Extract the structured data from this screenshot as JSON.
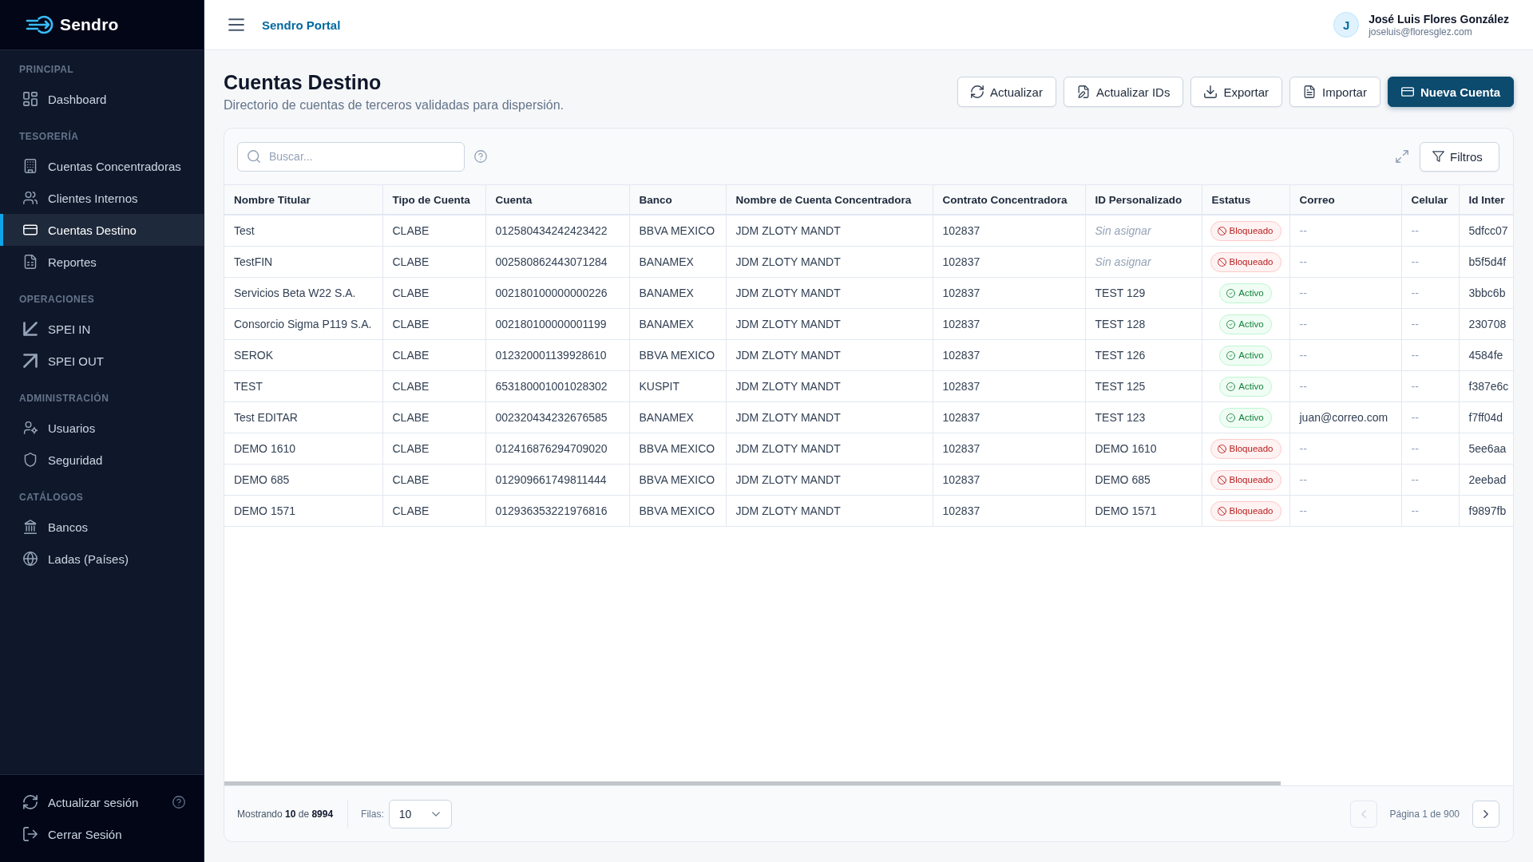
{
  "sidebar": {
    "brand": "Sendro",
    "sections": [
      {
        "label": "PRINCIPAL",
        "items": [
          {
            "label": "Dashboard",
            "selected": false
          }
        ]
      },
      {
        "label": "TESORERÍA",
        "items": [
          {
            "label": "Cuentas Concentradoras",
            "selected": false
          },
          {
            "label": "Clientes Internos",
            "selected": false
          },
          {
            "label": "Cuentas Destino",
            "selected": true
          },
          {
            "label": "Reportes",
            "selected": false
          }
        ]
      },
      {
        "label": "OPERACIONES",
        "items": [
          {
            "label": "SPEI IN",
            "selected": false
          },
          {
            "label": "SPEI OUT",
            "selected": false
          }
        ]
      },
      {
        "label": "ADMINISTRACIÓN",
        "items": [
          {
            "label": "Usuarios",
            "selected": false
          },
          {
            "label": "Seguridad",
            "selected": false
          }
        ]
      },
      {
        "label": "CATÁLOGOS",
        "items": [
          {
            "label": "Bancos",
            "selected": false
          },
          {
            "label": "Ladas (Países)",
            "selected": false
          }
        ]
      }
    ],
    "session_items": [
      {
        "label": "Actualizar sesión"
      },
      {
        "label": "Cerrar Sesión"
      }
    ]
  },
  "header": {
    "title": "Sendro Portal",
    "user": {
      "initial": "J",
      "name": "José Luis Flores González",
      "email": "joseluis@floresglez.com"
    }
  },
  "page": {
    "title": "Cuentas Destino",
    "subtitle": "Directorio de cuentas de terceros validadas para dispersión.",
    "actions": [
      {
        "label": "Actualizar",
        "primary": false
      },
      {
        "label": "Actualizar IDs",
        "primary": false
      },
      {
        "label": "Exportar",
        "primary": false
      },
      {
        "label": "Importar",
        "primary": false
      },
      {
        "label": "Nueva Cuenta",
        "primary": true
      }
    ]
  },
  "toolbar": {
    "search": {
      "placeholder": "Buscar..."
    },
    "filter_button": "Filtros"
  },
  "table": {
    "columns": [
      {
        "label": "Nombre Titular"
      },
      {
        "label": "Tipo de Cuenta"
      },
      {
        "label": "Cuenta"
      },
      {
        "label": "Banco"
      },
      {
        "label": "Nombre de Cuenta Concentradora"
      },
      {
        "label": "Contrato Concentradora"
      },
      {
        "label": "ID Personalizado"
      },
      {
        "label": "Estatus"
      },
      {
        "label": "Correo"
      },
      {
        "label": "Celular"
      },
      {
        "label": "Id Inter"
      }
    ],
    "rows": [
      {
        "cells": [
          {
            "kind": "text",
            "text": "Test"
          },
          {
            "kind": "text",
            "text": "CLABE"
          },
          {
            "kind": "text",
            "text": "012580434242423422"
          },
          {
            "kind": "text",
            "text": "BBVA MEXICO"
          },
          {
            "kind": "text",
            "text": "JDM ZLOTY MANDT"
          },
          {
            "kind": "text",
            "text": "102837"
          },
          {
            "kind": "unassigned",
            "text": "Sin asignar"
          },
          {
            "kind": "blocked",
            "text": "Bloqueado"
          },
          {
            "kind": "empty",
            "text": "--"
          },
          {
            "kind": "empty",
            "text": "--"
          },
          {
            "kind": "text",
            "text": "5dfcc07"
          }
        ]
      },
      {
        "cells": [
          {
            "kind": "text",
            "text": "TestFIN"
          },
          {
            "kind": "text",
            "text": "CLABE"
          },
          {
            "kind": "text",
            "text": "002580862443071284"
          },
          {
            "kind": "text",
            "text": "BANAMEX"
          },
          {
            "kind": "text",
            "text": "JDM ZLOTY MANDT"
          },
          {
            "kind": "text",
            "text": "102837"
          },
          {
            "kind": "unassigned",
            "text": "Sin asignar"
          },
          {
            "kind": "blocked",
            "text": "Bloqueado"
          },
          {
            "kind": "empty",
            "text": "--"
          },
          {
            "kind": "empty",
            "text": "--"
          },
          {
            "kind": "text",
            "text": "b5f5d4f"
          }
        ]
      },
      {
        "cells": [
          {
            "kind": "text",
            "text": "Servicios Beta W22 S.A."
          },
          {
            "kind": "text",
            "text": "CLABE"
          },
          {
            "kind": "text",
            "text": "002180100000000226"
          },
          {
            "kind": "text",
            "text": "BANAMEX"
          },
          {
            "kind": "text",
            "text": "JDM ZLOTY MANDT"
          },
          {
            "kind": "text",
            "text": "102837"
          },
          {
            "kind": "text",
            "text": "TEST 129"
          },
          {
            "kind": "active",
            "text": "Activo"
          },
          {
            "kind": "empty",
            "text": "--"
          },
          {
            "kind": "empty",
            "text": "--"
          },
          {
            "kind": "text",
            "text": "3bbc6b"
          }
        ]
      },
      {
        "cells": [
          {
            "kind": "text",
            "text": "Consorcio Sigma P119 S.A."
          },
          {
            "kind": "text",
            "text": "CLABE"
          },
          {
            "kind": "text",
            "text": "002180100000001199"
          },
          {
            "kind": "text",
            "text": "BANAMEX"
          },
          {
            "kind": "text",
            "text": "JDM ZLOTY MANDT"
          },
          {
            "kind": "text",
            "text": "102837"
          },
          {
            "kind": "text",
            "text": "TEST 128"
          },
          {
            "kind": "active",
            "text": "Activo"
          },
          {
            "kind": "empty",
            "text": "--"
          },
          {
            "kind": "empty",
            "text": "--"
          },
          {
            "kind": "text",
            "text": "230708"
          }
        ]
      },
      {
        "cells": [
          {
            "kind": "text",
            "text": "SEROK"
          },
          {
            "kind": "text",
            "text": "CLABE"
          },
          {
            "kind": "text",
            "text": "012320001139928610"
          },
          {
            "kind": "text",
            "text": "BBVA MEXICO"
          },
          {
            "kind": "text",
            "text": "JDM ZLOTY MANDT"
          },
          {
            "kind": "text",
            "text": "102837"
          },
          {
            "kind": "text",
            "text": "TEST 126"
          },
          {
            "kind": "active",
            "text": "Activo"
          },
          {
            "kind": "empty",
            "text": "--"
          },
          {
            "kind": "empty",
            "text": "--"
          },
          {
            "kind": "text",
            "text": "4584fe"
          }
        ]
      },
      {
        "cells": [
          {
            "kind": "text",
            "text": "TEST"
          },
          {
            "kind": "text",
            "text": "CLABE"
          },
          {
            "kind": "text",
            "text": "653180001001028302"
          },
          {
            "kind": "text",
            "text": "KUSPIT"
          },
          {
            "kind": "text",
            "text": "JDM ZLOTY MANDT"
          },
          {
            "kind": "text",
            "text": "102837"
          },
          {
            "kind": "text",
            "text": "TEST 125"
          },
          {
            "kind": "active",
            "text": "Activo"
          },
          {
            "kind": "empty",
            "text": "--"
          },
          {
            "kind": "empty",
            "text": "--"
          },
          {
            "kind": "text",
            "text": "f387e6c"
          }
        ]
      },
      {
        "cells": [
          {
            "kind": "text",
            "text": "Test EDITAR"
          },
          {
            "kind": "text",
            "text": "CLABE"
          },
          {
            "kind": "text",
            "text": "002320434232676585"
          },
          {
            "kind": "text",
            "text": "BANAMEX"
          },
          {
            "kind": "text",
            "text": "JDM ZLOTY MANDT"
          },
          {
            "kind": "text",
            "text": "102837"
          },
          {
            "kind": "text",
            "text": "TEST 123"
          },
          {
            "kind": "active",
            "text": "Activo"
          },
          {
            "kind": "text",
            "text": "juan@correo.com"
          },
          {
            "kind": "empty",
            "text": "--"
          },
          {
            "kind": "text",
            "text": "f7ff04d"
          }
        ]
      },
      {
        "cells": [
          {
            "kind": "text",
            "text": "DEMO 1610"
          },
          {
            "kind": "text",
            "text": "CLABE"
          },
          {
            "kind": "text",
            "text": "012416876294709020"
          },
          {
            "kind": "text",
            "text": "BBVA MEXICO"
          },
          {
            "kind": "text",
            "text": "JDM ZLOTY MANDT"
          },
          {
            "kind": "text",
            "text": "102837"
          },
          {
            "kind": "text",
            "text": "DEMO 1610"
          },
          {
            "kind": "blocked",
            "text": "Bloqueado"
          },
          {
            "kind": "empty",
            "text": "--"
          },
          {
            "kind": "empty",
            "text": "--"
          },
          {
            "kind": "text",
            "text": "5ee6aa"
          }
        ]
      },
      {
        "cells": [
          {
            "kind": "text",
            "text": "DEMO 685"
          },
          {
            "kind": "text",
            "text": "CLABE"
          },
          {
            "kind": "text",
            "text": "012909661749811444"
          },
          {
            "kind": "text",
            "text": "BBVA MEXICO"
          },
          {
            "kind": "text",
            "text": "JDM ZLOTY MANDT"
          },
          {
            "kind": "text",
            "text": "102837"
          },
          {
            "kind": "text",
            "text": "DEMO 685"
          },
          {
            "kind": "blocked",
            "text": "Bloqueado"
          },
          {
            "kind": "empty",
            "text": "--"
          },
          {
            "kind": "empty",
            "text": "--"
          },
          {
            "kind": "text",
            "text": "2eebad"
          }
        ]
      },
      {
        "cells": [
          {
            "kind": "text",
            "text": "DEMO 1571"
          },
          {
            "kind": "text",
            "text": "CLABE"
          },
          {
            "kind": "text",
            "text": "012936353221976816"
          },
          {
            "kind": "text",
            "text": "BBVA MEXICO"
          },
          {
            "kind": "text",
            "text": "JDM ZLOTY MANDT"
          },
          {
            "kind": "text",
            "text": "102837"
          },
          {
            "kind": "text",
            "text": "DEMO 1571"
          },
          {
            "kind": "blocked",
            "text": "Bloqueado"
          },
          {
            "kind": "empty",
            "text": "--"
          },
          {
            "kind": "empty",
            "text": "--"
          },
          {
            "kind": "text",
            "text": "f9897fb"
          }
        ]
      }
    ]
  },
  "footer": {
    "summary": "Mostrando **10** de **8994**",
    "rows_label": "Filas:",
    "rows_select": {
      "value": "10"
    },
    "pagination": {
      "label": "Página 1 de 900",
      "previous": {
        "disabled": true
      },
      "next": {
        "disabled": false
      }
    }
  }
}
